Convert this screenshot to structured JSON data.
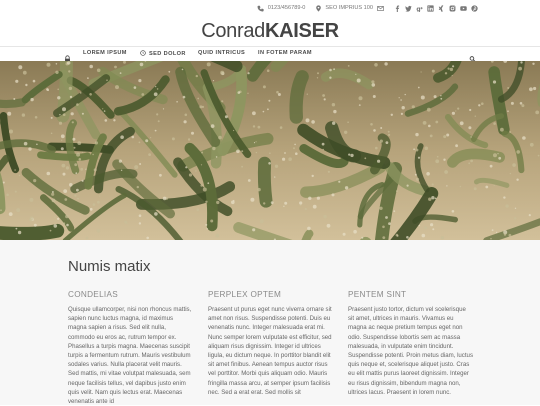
{
  "topbar": {
    "phone": "0123/456789-0",
    "address": "SEO IMPRIUS 100",
    "icons": [
      "phone-icon",
      "location-icon",
      "mail-icon",
      "facebook-icon",
      "twitter-icon",
      "google-plus-icon",
      "linkedin-icon",
      "xing-icon",
      "instagram-icon",
      "youtube-icon",
      "pinterest-icon"
    ]
  },
  "logo": {
    "part1": "Conrad",
    "part2": "KAISER"
  },
  "nav": {
    "items": [
      {
        "label": "LOREM IPSUM"
      },
      {
        "label": "SED DOLOR"
      },
      {
        "label": "QUID INTRICUS"
      },
      {
        "label": "IN FOTEM PARAM"
      }
    ]
  },
  "hero": {
    "image": "cactus-photo"
  },
  "section": {
    "title": "Numis matix",
    "columns": [
      {
        "heading": "CONDELIAS",
        "text": "Quisque ullamcorper, nisi non rhoncus mattis, sapien nunc luctus magna, id maximus magna sapien a risus. Sed elit nulla, commodo eu eros ac, rutrum tempor ex. Phasellus a turpis magna. Maecenas suscipit turpis a fermentum rutrum. Mauris vestibulum sodales varius. Nulla placerat velit mauris. Sed mattis, mi vitae volutpat malesuada, sem neque facilisis tellus, vel dapibus justo enim quis velit. Nam quis lectus erat. Maecenas venenatis ante id"
      },
      {
        "heading": "PERPLEX OPTEM",
        "text": "Praesent ut purus eget nunc viverra ornare sit amet non risus. Suspendisse potenti. Duis eu venenatis nunc. Integer malesuada erat mi. Nunc semper lorem vulputate est efficitur, sed aliquam risus dignissim. Integer id ultrices ligula, eu dictum neque. In porttitor blandit elit sit amet finibus. Aenean tempus auctor risus vel porttitor. Morbi quis aliquam odio. Mauris fringilla massa arcu, at semper ipsum facilisis nec. Sed a erat erat. Sed mollis sit"
      },
      {
        "heading": "PENTEM SINT",
        "text": "Praesent justo tortor, dictum vel scelerisque sit amet, ultrices in mauris. Vivamus eu magna ac neque pretium tempus eget non odio. Suspendisse lobortis sem ac massa malesuada, in vulputate enim tincidunt. Suspendisse potenti. Proin metus diam, luctus quis neque et, scelerisque aliquet justo. Cras eu elit mattis purus laoreet dignissim. Integer eu risus dignissim, bibendum magna non, ultrices lacus. Praesent in lorem nunc."
      }
    ]
  },
  "colors": {
    "accent": "#444444",
    "grey_bg": "#f7f7f7"
  }
}
